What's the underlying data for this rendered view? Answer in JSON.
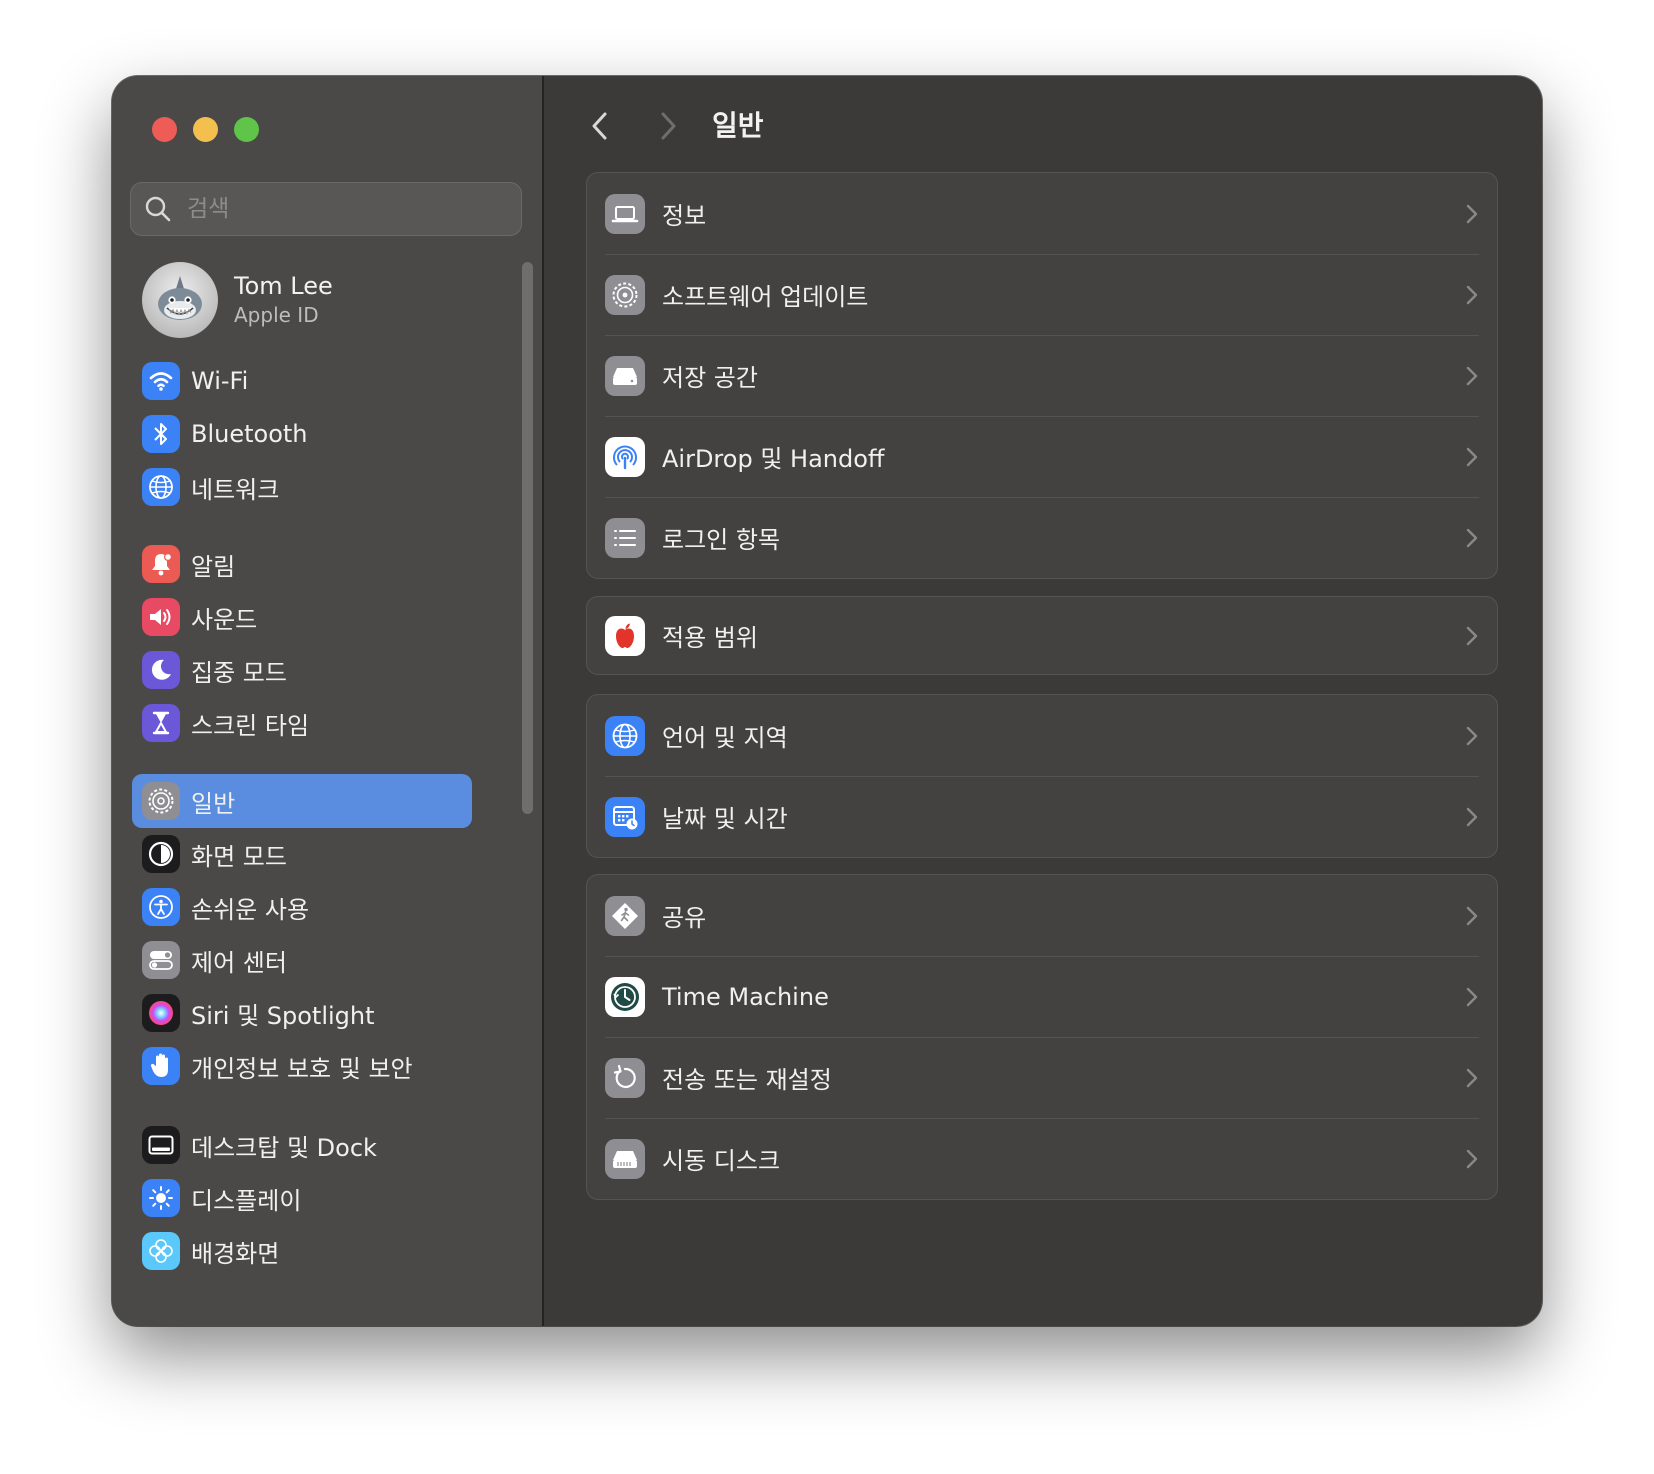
{
  "window": {
    "title": "일반"
  },
  "sidebar": {
    "search_placeholder": "검색",
    "profile": {
      "name": "Tom Lee",
      "subtitle": "Apple ID"
    },
    "items": [
      {
        "label": "Wi-Fi",
        "icon": "wifi-icon",
        "color": "#3b82f6"
      },
      {
        "label": "Bluetooth",
        "icon": "bluetooth-icon",
        "color": "#3b82f6"
      },
      {
        "label": "네트워크",
        "icon": "globe-icon",
        "color": "#3b82f6"
      },
      {
        "label": "알림",
        "icon": "bell-icon",
        "color": "#ec5b53"
      },
      {
        "label": "사운드",
        "icon": "speaker-icon",
        "color": "#e94a63"
      },
      {
        "label": "집중 모드",
        "icon": "moon-icon",
        "color": "#6a58d8"
      },
      {
        "label": "스크린 타임",
        "icon": "hourglass-icon",
        "color": "#6a58d8"
      },
      {
        "label": "일반",
        "icon": "gear-icon",
        "color": "#8e8e93",
        "selected": true
      },
      {
        "label": "화면 모드",
        "icon": "appearance-icon",
        "color": "#1c1c1e"
      },
      {
        "label": "손쉬운 사용",
        "icon": "accessibility-icon",
        "color": "#3b82f6"
      },
      {
        "label": "제어 센터",
        "icon": "toggles-icon",
        "color": "#8e8e93"
      },
      {
        "label": "Siri 및 Spotlight",
        "icon": "siri-icon",
        "color": "#1c1c1e"
      },
      {
        "label": "개인정보 보호 및 보안",
        "icon": "hand-icon",
        "color": "#3b82f6"
      },
      {
        "label": "데스크탑 및 Dock",
        "icon": "dock-icon",
        "color": "#1c1c1e"
      },
      {
        "label": "디스플레이",
        "icon": "brightness-icon",
        "color": "#3b82f6"
      },
      {
        "label": "배경화면",
        "icon": "flower-icon",
        "color": "#5ac8fa"
      }
    ]
  },
  "main": {
    "title": "일반",
    "groups": [
      {
        "rows": [
          {
            "label": "정보",
            "icon": "laptop-icon",
            "color": "#8e8e93"
          },
          {
            "label": "소프트웨어 업데이트",
            "icon": "gear-badge-icon",
            "color": "#8e8e93"
          },
          {
            "label": "저장 공간",
            "icon": "drive-icon",
            "color": "#8e8e93"
          },
          {
            "label": "AirDrop 및 Handoff",
            "icon": "airdrop-icon",
            "color": "#ffffff"
          },
          {
            "label": "로그인 항목",
            "icon": "list-icon",
            "color": "#8e8e93"
          }
        ]
      },
      {
        "rows": [
          {
            "label": "적용 범위",
            "icon": "apple-logo-icon",
            "color": "#ffffff"
          }
        ]
      },
      {
        "rows": [
          {
            "label": "언어 및 지역",
            "icon": "globe-icon",
            "color": "#3b82f6"
          },
          {
            "label": "날짜 및 시간",
            "icon": "calendar-clock-icon",
            "color": "#3b82f6"
          }
        ]
      },
      {
        "rows": [
          {
            "label": "공유",
            "icon": "sharing-icon",
            "color": "#8e8e93"
          },
          {
            "label": "Time Machine",
            "icon": "time-machine-icon",
            "color": "#1f4a45"
          },
          {
            "label": "전송 또는 재설정",
            "icon": "reset-icon",
            "color": "#8e8e93"
          },
          {
            "label": "시동 디스크",
            "icon": "startup-disk-icon",
            "color": "#8e8e93"
          }
        ]
      }
    ]
  }
}
